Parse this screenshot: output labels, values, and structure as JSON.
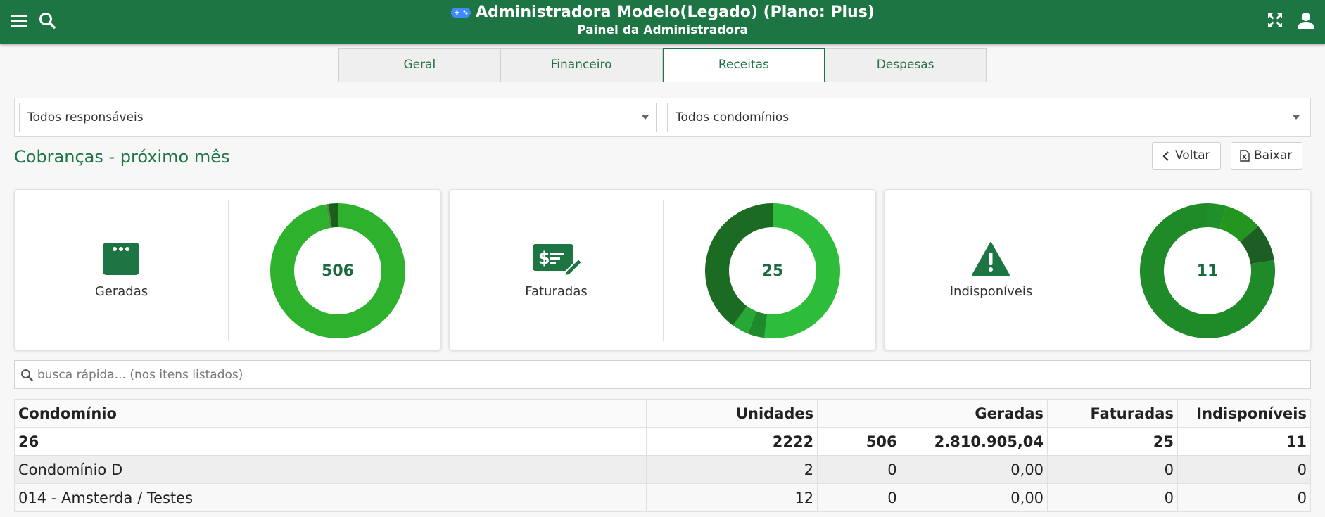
{
  "header": {
    "title": "Administradora Modelo(Legado) (Plano: Plus)",
    "subtitle": "Painel da Administradora",
    "icons": [
      "menu-icon",
      "search-icon",
      "gamepad-icon",
      "fullscreen-icon",
      "user-icon"
    ],
    "color": "#1c7543"
  },
  "tabs": [
    {
      "label": "Geral"
    },
    {
      "label": "Financeiro"
    },
    {
      "label": "Receitas",
      "active": true
    },
    {
      "label": "Despesas"
    }
  ],
  "filters": {
    "responsaveis": "Todos responsáveis",
    "condominios": "Todos condomínios"
  },
  "section": {
    "title": "Cobranças - próximo mês",
    "back_label": "Voltar",
    "download_label": "Baixar"
  },
  "cards": [
    {
      "label": "Geradas",
      "value": "506",
      "icon": "window-dots-icon",
      "segments": [
        {
          "fraction": 0.972,
          "color": "#2eb22e"
        },
        {
          "fraction": 0.006,
          "color": "#4b8f3a"
        },
        {
          "fraction": 0.022,
          "color": "#1b5e20"
        }
      ]
    },
    {
      "label": "Faturadas",
      "value": "25",
      "icon": "bill-edit-icon",
      "segments": [
        {
          "fraction": 0.52,
          "color": "#2dbd3a"
        },
        {
          "fraction": 0.04,
          "color": "#1f8a2c"
        },
        {
          "fraction": 0.04,
          "color": "#27a835"
        },
        {
          "fraction": 0.4,
          "color": "#1b6b22"
        }
      ]
    },
    {
      "label": "Indisponíveis",
      "value": "11",
      "icon": "warning-icon",
      "segments": [
        {
          "fraction": 0.045,
          "color": "#1f8f2a"
        },
        {
          "fraction": 0.09,
          "color": "#22961f"
        },
        {
          "fraction": 0.09,
          "color": "#1d5e25"
        },
        {
          "fraction": 0.775,
          "color": "#1e8a28"
        }
      ]
    }
  ],
  "search": {
    "placeholder": "busca rápida... (nos itens listados)"
  },
  "table": {
    "headers": [
      "Condomínio",
      "Unidades",
      "Geradas",
      "Faturadas",
      "Indisponíveis"
    ],
    "total": {
      "condominio": "26",
      "unidades": "2222",
      "geradas_count": "506",
      "geradas_valor": "2.810.905,04",
      "faturadas": "25",
      "indisponiveis": "11"
    },
    "rows": [
      {
        "condominio": "Condomínio D",
        "unidades": "2",
        "geradas_count": "0",
        "geradas_valor": "0,00",
        "faturadas": "0",
        "indisponiveis": "0"
      },
      {
        "condominio": "014 - Amsterda / Testes",
        "unidades": "12",
        "geradas_count": "0",
        "geradas_valor": "0,00",
        "faturadas": "0",
        "indisponiveis": "0"
      }
    ]
  }
}
